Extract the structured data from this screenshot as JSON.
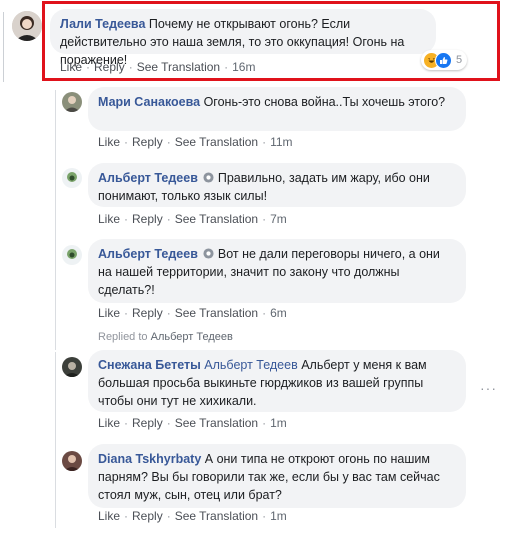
{
  "actions": {
    "like": "Like",
    "reply": "Reply",
    "translate": "See Translation",
    "sep": "·"
  },
  "main": {
    "author": "Лали Тедеева",
    "text": "Почему не открывают огонь? Если действительно это наша земля, то это оккупация! Огонь на поражение!",
    "time": "16m",
    "reaction_count": "5",
    "reaction_icons": [
      "haha-icon",
      "like-icon"
    ]
  },
  "replies": [
    {
      "author": "Мари Санакоева",
      "text": "Огонь-это снова война..Ты хочешь этого?",
      "time": "11m",
      "verified": false
    },
    {
      "author": "Альберт Тедеев",
      "text": "Правильно, задать им жару, ибо они понимают, только язык силы!",
      "time": "7m",
      "verified": true
    },
    {
      "author": "Альберт Тедеев",
      "text": "Вот не дали переговоры ничего, а они на нашей территории, значит по закону что должны сделать?!",
      "time": "6m",
      "verified": true
    },
    {
      "author": "Снежана Бететы",
      "mention": "Альберт Тедеев",
      "text": "Альберт у меня к вам большая просьба выкиньте гюрджиков из вашей группы чтобы они тут не хихикали.",
      "time": "1m",
      "verified": false
    },
    {
      "author": "Diana Tskhyrbaty",
      "text": "А они типа не откроют огонь по нашим парням? Вы бы говорили так же, если бы у вас там сейчас стоял муж, сын, отец или брат?",
      "time": "1m",
      "verified": false
    }
  ],
  "replied_to": {
    "prefix": "Replied to",
    "name": "Альберт Тедеев"
  },
  "more_label": "···",
  "colors": {
    "link": "#385898",
    "highlight": "#e0121b",
    "bubble": "#f2f3f5"
  }
}
